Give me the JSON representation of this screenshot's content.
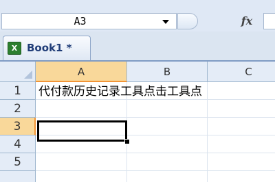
{
  "formula_bar": {
    "name_box_value": "A3",
    "fx_label": "fx",
    "formula_value": ""
  },
  "workbook_tab": {
    "title": "Book1 *",
    "icon_label": "X"
  },
  "grid": {
    "columns": [
      "A",
      "B",
      "C"
    ],
    "selected_column": "A",
    "rows": [
      "1",
      "2",
      "3",
      "4",
      "5"
    ],
    "selected_row": "3",
    "active_cell": "A3",
    "cells": {
      "A1": "代付款历史记录工具点击工具点"
    }
  },
  "colors": {
    "header_bg": "#e4ecf7",
    "selected_header_bg": "#f9d89a",
    "selection_accent": "#f29436",
    "grid_line": "#dae3ee"
  }
}
